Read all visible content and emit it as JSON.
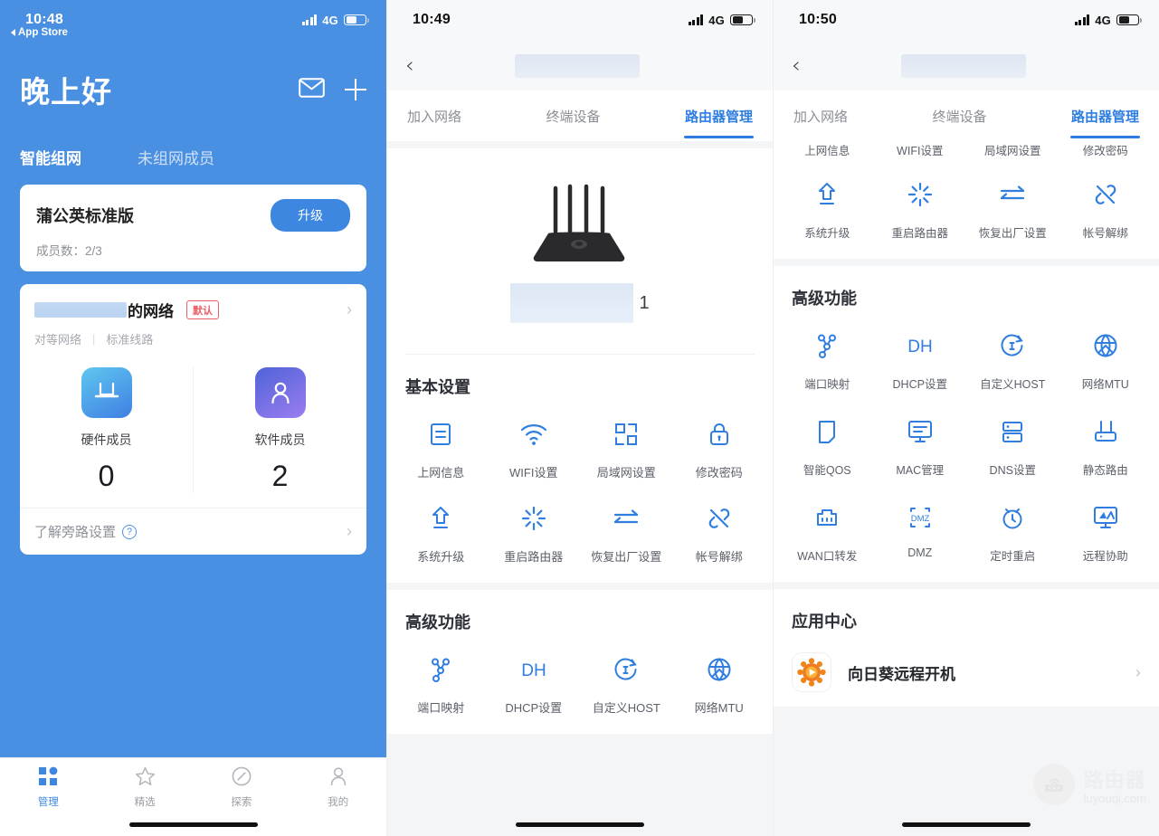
{
  "panel1": {
    "status": {
      "time": "10:48",
      "back_app": "App Store",
      "network": "4G"
    },
    "header": {
      "greeting": "晚上好",
      "mail_icon": "mail-icon",
      "add_icon": "plus-icon"
    },
    "segments": [
      {
        "label": "智能组网",
        "selected": true
      },
      {
        "label": "未组网成员",
        "selected": false
      }
    ],
    "plan_card": {
      "name": "蒲公英标准版",
      "upgrade_label": "升级",
      "members_label": "成员数：2/3"
    },
    "network_card": {
      "name_suffix": "的网络",
      "badge": "默认",
      "meta": [
        "对等网络",
        "标准线路"
      ],
      "members": [
        {
          "icon": "router-icon",
          "label": "硬件成员",
          "count": "0"
        },
        {
          "icon": "person-icon",
          "label": "软件成员",
          "count": "2"
        }
      ],
      "footer_text": "了解旁路设置",
      "footer_help_icon": "question-circle-icon"
    },
    "tabbar": [
      {
        "icon": "grid-icon",
        "label": "管理",
        "active": true
      },
      {
        "icon": "star-icon",
        "label": "精选",
        "active": false
      },
      {
        "icon": "compass-icon",
        "label": "探索",
        "active": false
      },
      {
        "icon": "person-icon",
        "label": "我的",
        "active": false
      }
    ]
  },
  "panel2": {
    "status": {
      "time": "10:49",
      "network": "4G"
    },
    "nav": {
      "back_icon": "chevron-left-icon"
    },
    "tabs": [
      {
        "label": "加入网络",
        "selected": false
      },
      {
        "label": "终端设备",
        "selected": false
      },
      {
        "label": "路由器管理",
        "selected": true
      }
    ],
    "device": {
      "image": "router-photo",
      "name_number": "1"
    },
    "basic": {
      "title": "基本设置",
      "items": [
        {
          "icon": "document-icon",
          "label": "上网信息"
        },
        {
          "icon": "wifi-icon",
          "label": "WIFI设置"
        },
        {
          "icon": "lan-icon",
          "label": "局域网设置"
        },
        {
          "icon": "lock-icon",
          "label": "修改密码"
        },
        {
          "icon": "upgrade-arrow-icon",
          "label": "系统升级"
        },
        {
          "icon": "restart-icon",
          "label": "重启路由器"
        },
        {
          "icon": "factory-reset-icon",
          "label": "恢复出厂设置"
        },
        {
          "icon": "unlink-icon",
          "label": "帐号解绑"
        }
      ]
    },
    "advanced": {
      "title": "高级功能",
      "items": [
        {
          "icon": "port-map-icon",
          "label": "端口映射"
        },
        {
          "icon": "dhcp-icon",
          "label": "DHCP设置"
        },
        {
          "icon": "host-icon",
          "label": "自定义HOST"
        },
        {
          "icon": "mtu-icon",
          "label": "网络MTU"
        }
      ]
    }
  },
  "panel3": {
    "status": {
      "time": "10:50",
      "network": "4G"
    },
    "nav": {
      "back_icon": "chevron-left-icon"
    },
    "tabs": [
      {
        "label": "加入网络",
        "selected": false
      },
      {
        "label": "终端设备",
        "selected": false
      },
      {
        "label": "路由器管理",
        "selected": true
      }
    ],
    "basic": {
      "items": [
        {
          "icon": "document-icon",
          "label": "上网信息"
        },
        {
          "icon": "wifi-icon",
          "label": "WIFI设置"
        },
        {
          "icon": "lan-icon",
          "label": "局域网设置"
        },
        {
          "icon": "lock-icon",
          "label": "修改密码"
        },
        {
          "icon": "upgrade-arrow-icon",
          "label": "系统升级"
        },
        {
          "icon": "restart-icon",
          "label": "重启路由器"
        },
        {
          "icon": "factory-reset-icon",
          "label": "恢复出厂设置"
        },
        {
          "icon": "unlink-icon",
          "label": "帐号解绑"
        }
      ]
    },
    "advanced": {
      "title": "高级功能",
      "items": [
        {
          "icon": "port-map-icon",
          "label": "端口映射"
        },
        {
          "icon": "dhcp-icon",
          "label": "DHCP设置"
        },
        {
          "icon": "host-icon",
          "label": "自定义HOST"
        },
        {
          "icon": "mtu-icon",
          "label": "网络MTU"
        },
        {
          "icon": "qos-icon",
          "label": "智能QOS"
        },
        {
          "icon": "monitor-icon",
          "label": "MAC管理"
        },
        {
          "icon": "server-icon",
          "label": "DNS设置"
        },
        {
          "icon": "static-route-icon",
          "label": "静态路由"
        },
        {
          "icon": "wan-port-icon",
          "label": "WAN口转发"
        },
        {
          "icon": "dmz-icon",
          "label": "DMZ"
        },
        {
          "icon": "timer-icon",
          "label": "定时重启"
        },
        {
          "icon": "remote-assist-icon",
          "label": "远程协助"
        }
      ]
    },
    "appcenter": {
      "title": "应用中心",
      "app": {
        "icon": "sunflower-icon",
        "name": "向日葵远程开机",
        "chevron": "chevron-right-icon"
      }
    },
    "watermark": {
      "cn": "路由器",
      "en": "luyouqi.com",
      "icon": "router-watermark-icon"
    }
  },
  "colors": {
    "brand_blue": "#4a90e2",
    "accent_blue": "#2e7de0",
    "icon_blue": "#2f7ee0",
    "badge_red": "#e8616a",
    "sunflower_orange": "#ef7c22"
  }
}
